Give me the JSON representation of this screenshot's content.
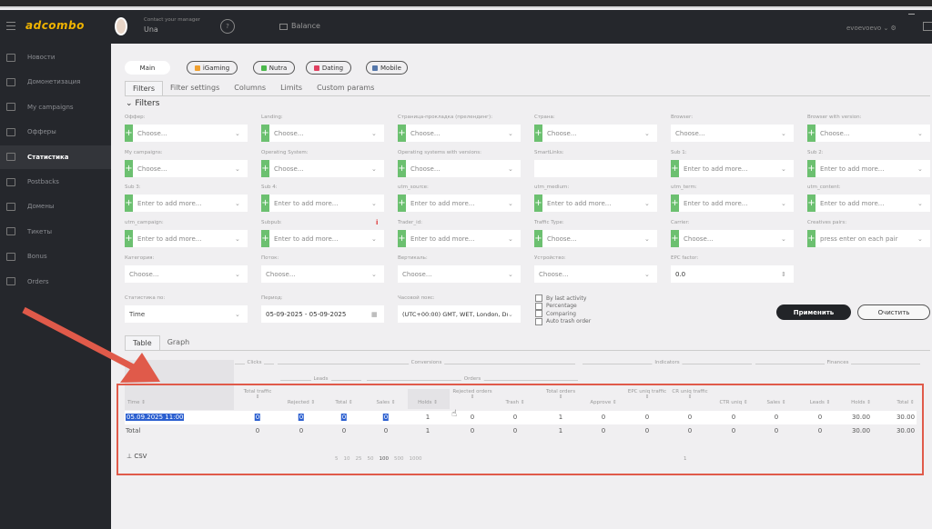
{
  "header": {
    "logo": "adcombo",
    "manager_caption": "Contact your manager",
    "manager_name": "Una",
    "help": "?",
    "balance": "Balance",
    "user": "evoevoevo"
  },
  "sidebar": {
    "items": [
      {
        "label": "Новости"
      },
      {
        "label": "Домонетизация"
      },
      {
        "label": "My campaigns"
      },
      {
        "label": "Офферы"
      },
      {
        "label": "Статистика",
        "active": true
      },
      {
        "label": "Postbacks"
      },
      {
        "label": "Домены"
      },
      {
        "label": "Тикеты"
      },
      {
        "label": "Bonus"
      },
      {
        "label": "Orders"
      }
    ]
  },
  "verticals": [
    "Main",
    "iGaming",
    "Nutra",
    "Dating",
    "Mobile"
  ],
  "settings_tabs": [
    "Filters",
    "Filter settings",
    "Columns",
    "Limits",
    "Custom params"
  ],
  "filters_title": "Filters",
  "filters": [
    {
      "label": "Оффер:",
      "value": "Choose...",
      "plus": true
    },
    {
      "label": "Landing:",
      "value": "Choose...",
      "plus": true
    },
    {
      "label": "Страница-прокладка (прелендинг):",
      "value": "Choose...",
      "plus": true
    },
    {
      "label": "Страна:",
      "value": "Choose...",
      "plus": true
    },
    {
      "label": "Browser:",
      "value": "Choose...",
      "plus": false
    },
    {
      "label": "Browser with version:",
      "value": "Choose...",
      "plus": true
    },
    {
      "label": "My campaigns:",
      "value": "Choose...",
      "plus": true
    },
    {
      "label": "Operating System:",
      "value": "Choose...",
      "plus": true
    },
    {
      "label": "Operating systems with versions:",
      "value": "Choose...",
      "plus": true
    },
    {
      "label": "SmartLinks:",
      "value": "",
      "plus": false,
      "nochev": true
    },
    {
      "label": "Sub 1:",
      "value": "Enter to add more...",
      "plus": true
    },
    {
      "label": "Sub 2:",
      "value": "Enter to add more...",
      "plus": true
    },
    {
      "label": "Sub 3:",
      "value": "Enter to add more...",
      "plus": true
    },
    {
      "label": "Sub 4:",
      "value": "Enter to add more...",
      "plus": true
    },
    {
      "label": "utm_source:",
      "value": "Enter to add more...",
      "plus": true
    },
    {
      "label": "utm_medium:",
      "value": "Enter to add more...",
      "plus": true
    },
    {
      "label": "utm_term:",
      "value": "Enter to add more...",
      "plus": true
    },
    {
      "label": "utm_content:",
      "value": "Enter to add more...",
      "plus": true
    },
    {
      "label": "utm_campaign:",
      "value": "Enter to add more...",
      "plus": true
    },
    {
      "label": "Subpub:",
      "value": "Enter to add more...",
      "plus": true,
      "info": "i"
    },
    {
      "label": "Trader_id:",
      "value": "Enter to add more...",
      "plus": true
    },
    {
      "label": "Traffic Type:",
      "value": "Choose...",
      "plus": true
    },
    {
      "label": "Carrier:",
      "value": "Choose...",
      "plus": true
    },
    {
      "label": "Creatives pairs:",
      "value": "press enter on each pair",
      "plus": true
    },
    {
      "label": "Категория:",
      "value": "Choose...",
      "plus": false
    },
    {
      "label": "Поток:",
      "value": "Choose...",
      "plus": false
    },
    {
      "label": "Вертикаль:",
      "value": "Choose...",
      "plus": false
    },
    {
      "label": "Устройство:",
      "value": "Choose...",
      "plus": false
    },
    {
      "label": "EPC factor:",
      "value": "0.0",
      "plus": false,
      "spin": true
    }
  ],
  "stats_by": {
    "label": "Статистика по:",
    "value": "Time"
  },
  "period": {
    "label": "Период:",
    "value": "05-09-2025 - 05-09-2025"
  },
  "timezone": {
    "label": "Часовой пояс:",
    "value": "(UTC+00:00) GMT, WET, London, Du..."
  },
  "checkboxes": [
    "By last activity",
    "Percentage",
    "Comparing",
    "Auto trash order"
  ],
  "apply": "Применить",
  "clear": "Очистить",
  "view_tabs": [
    "Table",
    "Graph"
  ],
  "table": {
    "groups": [
      "Clicks",
      "Conversions",
      "Indicators",
      "Finances"
    ],
    "subgroups": [
      "Leads",
      "Orders"
    ],
    "columns": [
      "Time",
      "Total traffic",
      "Rejected",
      "Total",
      "Sales",
      "Holds",
      "Rejected orders",
      "Trash",
      "Total orders",
      "Approve",
      "EPC uniq traffic",
      "CR uniq traffic",
      "CTR uniq",
      "Sales",
      "Leads",
      "Holds",
      "Total"
    ],
    "rows": [
      [
        "05.09.2025 11:00",
        "0",
        "0",
        "0",
        "0",
        "1",
        "0",
        "0",
        "1",
        "0",
        "0",
        "0",
        "0",
        "0",
        "0",
        "30.00",
        "30.00"
      ]
    ],
    "total": [
      "Total",
      "0",
      "0",
      "0",
      "0",
      "1",
      "0",
      "0",
      "1",
      "0",
      "0",
      "0",
      "0",
      "0",
      "0",
      "30.00",
      "30.00"
    ]
  },
  "csv": "CSV",
  "page_sizes": [
    "5",
    "10",
    "25",
    "50",
    "100",
    "500",
    "1000"
  ],
  "page": "1",
  "colors": {
    "accent_green": "#6cc070",
    "annotation_red": "#e05a4a",
    "sidebar": "#25272c"
  }
}
